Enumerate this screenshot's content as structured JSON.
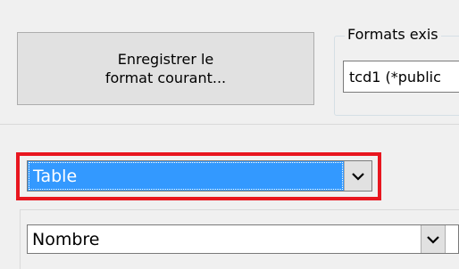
{
  "save_button": {
    "line1": "Enregistrer le",
    "line2": "format courant..."
  },
  "formats_group": {
    "legend": "Formats exis",
    "selected_value": "tcd1 (*public"
  },
  "table_combo": {
    "value": "Table",
    "arrow_icon": "chevron-down-icon"
  },
  "nombre_combo": {
    "value": "Nombre",
    "arrow_icon": "chevron-down-icon"
  },
  "colors": {
    "highlight": "#e8161f",
    "selection": "#3399ff"
  }
}
